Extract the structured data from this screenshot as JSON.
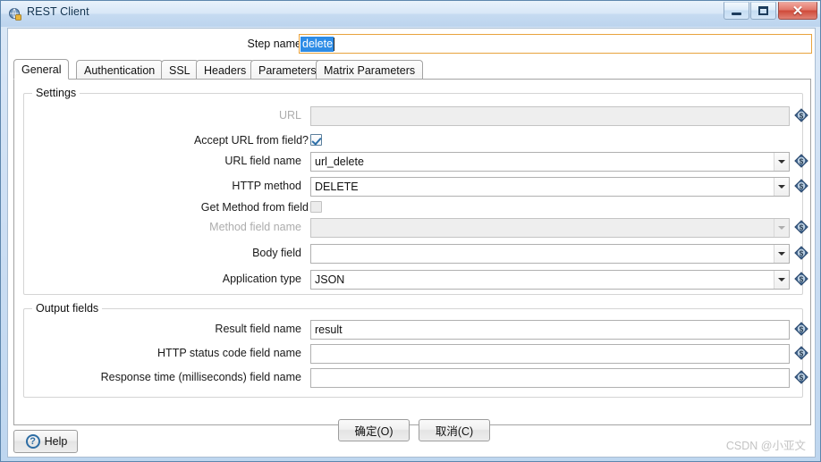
{
  "window": {
    "title": "REST Client",
    "icon": "rest-client-icon",
    "controls": {
      "minimize": "minimize-icon",
      "maximize": "maximize-icon",
      "close": "close-icon"
    }
  },
  "step": {
    "label": "Step name",
    "value": "delete",
    "placeholder": ""
  },
  "tabs": [
    {
      "label": "General",
      "active": true
    },
    {
      "label": "Authentication",
      "active": false
    },
    {
      "label": "SSL",
      "active": false
    },
    {
      "label": "Headers",
      "active": false
    },
    {
      "label": "Parameters",
      "active": false
    },
    {
      "label": "Matrix Parameters",
      "active": false
    }
  ],
  "settings": {
    "title": "Settings",
    "fields": {
      "url": {
        "label": "URL",
        "value": "",
        "disabled": true
      },
      "accept_url": {
        "label": "Accept URL from field?",
        "checked": true,
        "disabled": false
      },
      "url_field_name": {
        "label": "URL field name",
        "value": "url_delete",
        "disabled": false
      },
      "http_method": {
        "label": "HTTP method",
        "value": "DELETE",
        "disabled": false
      },
      "get_method": {
        "label": "Get Method from field",
        "checked": false,
        "disabled": true
      },
      "method_field": {
        "label": "Method field name",
        "value": "",
        "disabled": true
      },
      "body_field": {
        "label": "Body field",
        "value": "",
        "disabled": false
      },
      "application_type": {
        "label": "Application type",
        "value": "JSON",
        "disabled": false
      }
    }
  },
  "output": {
    "title": "Output fields",
    "fields": {
      "result": {
        "label": "Result field name",
        "value": "result"
      },
      "status_code": {
        "label": "HTTP status code field name",
        "value": ""
      },
      "response_time": {
        "label": "Response time (milliseconds) field name",
        "value": ""
      }
    }
  },
  "buttons": {
    "ok": "确定(O)",
    "cancel": "取消(C)",
    "help": "Help",
    "help_icon": "question-mark-icon"
  },
  "variable_icon": "variable-dollar-icon",
  "watermark": "CSDN @小亚文",
  "colors": {
    "accent": "#2d8ce6",
    "focus_border": "#e8a33d",
    "variable_icon": "#3c6089",
    "close_button": "#cf4a39"
  }
}
